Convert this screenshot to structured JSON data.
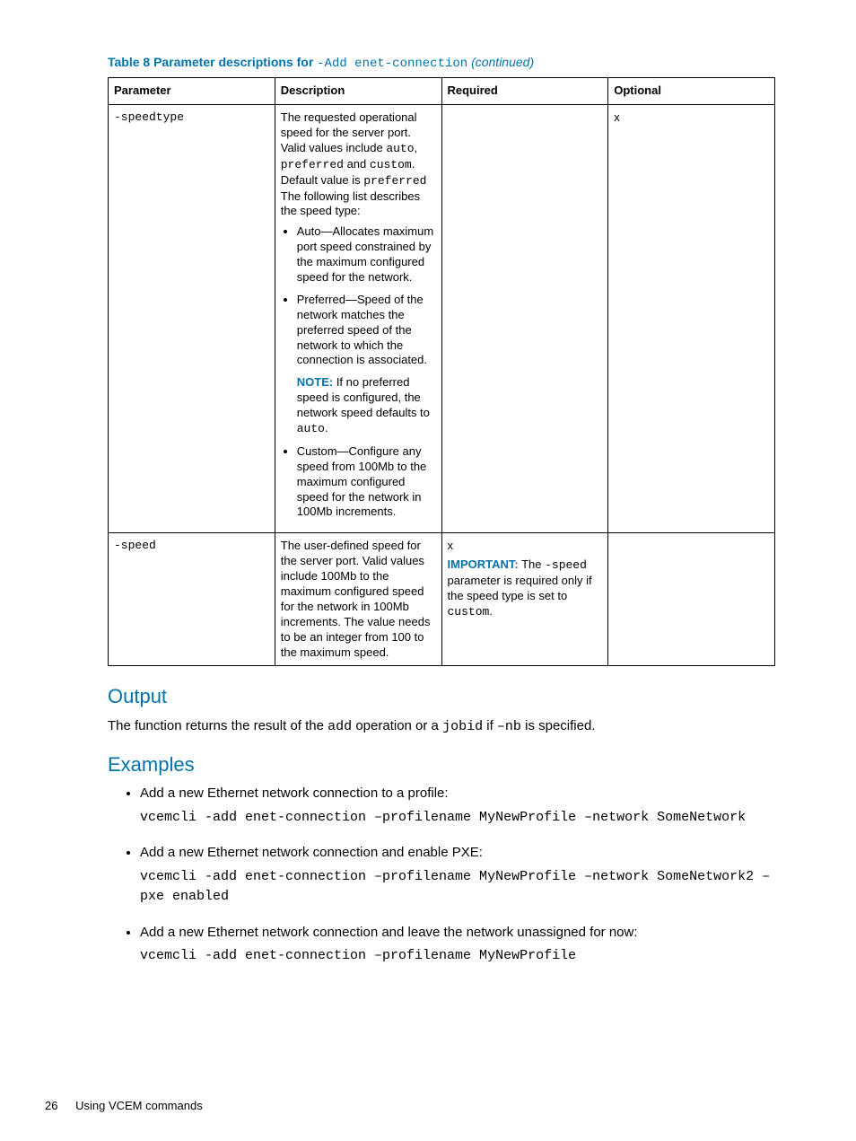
{
  "tableCaption": {
    "prefix": "Table 8 Parameter descriptions for ",
    "code": "-Add enet-connection",
    "suffix": " (continued)"
  },
  "headers": {
    "parameter": "Parameter",
    "description": "Description",
    "required": "Required",
    "optional": "Optional"
  },
  "row1": {
    "param": "-speedtype",
    "descIntro1": "The requested operational speed for the server port. Valid values include ",
    "auto": "auto",
    "comma": ", ",
    "preferred": "preferred",
    "and": " and ",
    "custom": "custom",
    "periodDefault": ". Default value is ",
    "preferred2": "preferred",
    "afterDefault": " The following list describes the speed type:",
    "b1": "Auto—Allocates maximum port speed constrained by the maximum configured speed for the network.",
    "b2": "Preferred—Speed of the network matches the preferred speed of the network to which the connection is associated.",
    "noteLabel": "NOTE:",
    "noteText": "   If no preferred speed is configured, the network speed defaults to ",
    "noteAuto": "auto",
    "notePeriod": ".",
    "b3": "Custom—Configure any speed from 100Mb to the maximum configured speed for the network in 100Mb increments.",
    "optional": "x"
  },
  "row2": {
    "param": "-speed",
    "desc": "The user-defined speed for the server port. Valid values include 100Mb to the maximum configured speed for the network in 100Mb increments. The value needs to be an integer from 100 to the maximum speed.",
    "reqX": "x",
    "importantLabel": "IMPORTANT:",
    "importantText1": "   The ",
    "speedCode": "-speed",
    "importantText2": " parameter is required only if the speed type is set to ",
    "customCode": "custom",
    "importantText3": "."
  },
  "outputHeading": "Output",
  "outputText1": "The function returns the result of the ",
  "outputAdd": "add",
  "outputText2": " operation or a ",
  "outputJobid": "jobid",
  "outputText3": " if ",
  "outputNb": "–nb",
  "outputText4": " is specified.",
  "examplesHeading": "Examples",
  "ex1": {
    "text": "Add a new Ethernet network connection to a profile:",
    "code": "vcemcli -add enet-connection –profilename MyNewProfile –network SomeNetwork"
  },
  "ex2": {
    "text": "Add a new Ethernet network connection and enable PXE:",
    "code": "vcemcli -add enet-connection –profilename MyNewProfile –network SomeNetwork2 –pxe enabled"
  },
  "ex3": {
    "text": "Add a new Ethernet network connection and leave the network unassigned for now:",
    "code": "vcemcli -add enet-connection –profilename MyNewProfile"
  },
  "footer": {
    "page": "26",
    "section": "Using VCEM commands"
  }
}
